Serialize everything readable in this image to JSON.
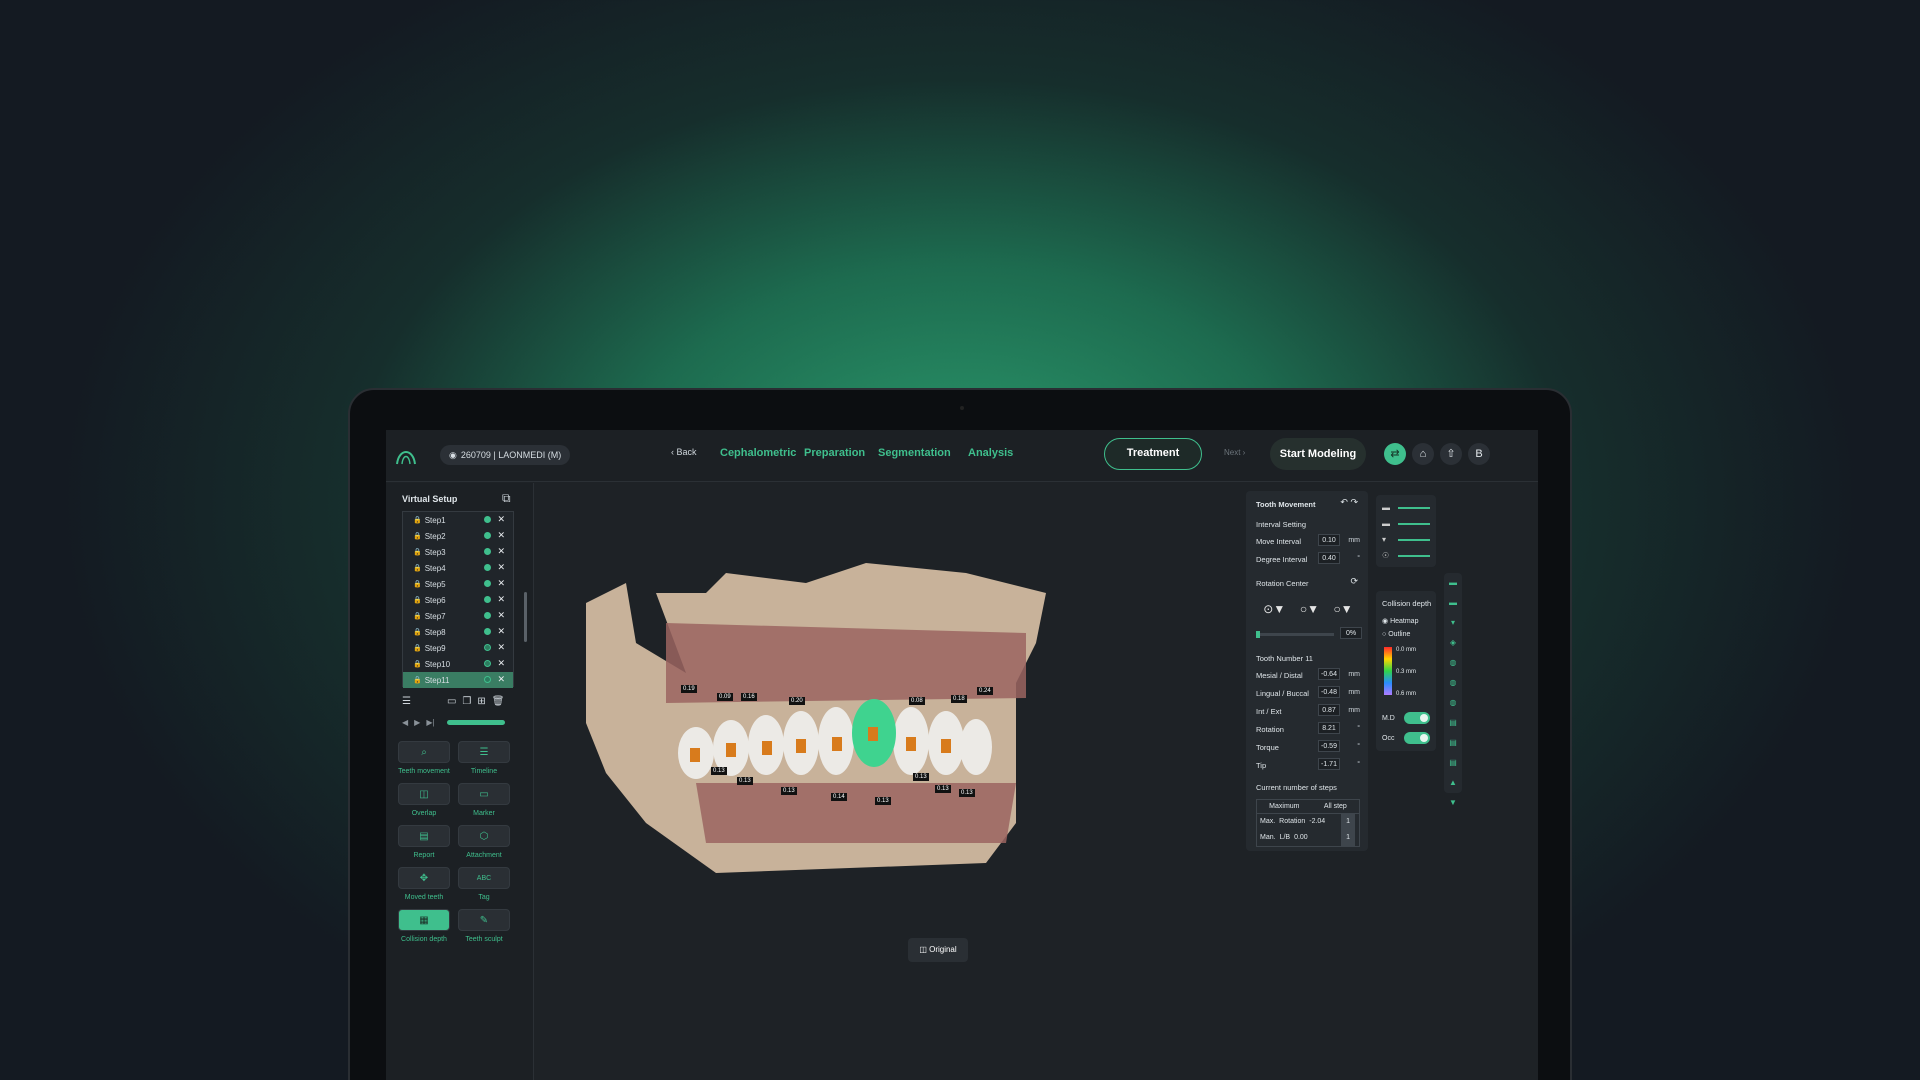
{
  "header": {
    "patient": "260709 | LAONMEDI (M)",
    "back": "Back",
    "tabs": [
      "Cephalometric",
      "Preparation",
      "Segmentation",
      "Analysis"
    ],
    "active_tab": "Treatment",
    "next": "Next",
    "start": "Start Modeling",
    "user_initial": "B"
  },
  "sidebar": {
    "title": "Virtual Setup",
    "steps": [
      "Step1",
      "Step2",
      "Step3",
      "Step4",
      "Step5",
      "Step6",
      "Step7",
      "Step8",
      "Step9",
      "Step10",
      "Step11"
    ],
    "tools": [
      {
        "label": "Teeth movement",
        "icon": "search-icon"
      },
      {
        "label": "Timeline",
        "icon": "timeline-icon"
      },
      {
        "label": "Overlap",
        "icon": "overlap-icon"
      },
      {
        "label": "Marker",
        "icon": "marker-icon"
      },
      {
        "label": "Report",
        "icon": "report-icon"
      },
      {
        "label": "Attachment",
        "icon": "cube-icon"
      },
      {
        "label": "Moved teeth",
        "icon": "move-icon"
      },
      {
        "label": "Tag",
        "icon": "ABC"
      },
      {
        "label": "Collision depth",
        "icon": "collision-icon"
      },
      {
        "label": "Teeth sculpt",
        "icon": "sculpt-icon"
      }
    ]
  },
  "tooth_movement": {
    "title": "Tooth Movement",
    "interval_setting": "Interval Setting",
    "move_interval_label": "Move Interval",
    "move_interval": "0.10",
    "move_unit": "mm",
    "degree_interval_label": "Degree Interval",
    "degree_interval": "0.40",
    "degree_unit": "°",
    "rotation_center": "Rotation Center",
    "percent": "0%",
    "tooth_number": "Tooth Number 11",
    "params": [
      {
        "label": "Mesial / Distal",
        "value": "-0.64",
        "unit": "mm"
      },
      {
        "label": "Lingual / Buccal",
        "value": "-0.48",
        "unit": "mm"
      },
      {
        "label": "Int / Ext",
        "value": "0.87",
        "unit": "mm"
      },
      {
        "label": "Rotation",
        "value": "8.21",
        "unit": "°"
      },
      {
        "label": "Torque",
        "value": "-0.59",
        "unit": "°"
      },
      {
        "label": "Tip",
        "value": "-1.71",
        "unit": "°"
      }
    ],
    "steps_title": "Current number of steps",
    "steps_head": [
      "Maximum",
      "All step"
    ],
    "steps_rows": [
      {
        "label": "Max.",
        "sub": "Rotation",
        "value": "-2.04",
        "step": "1"
      },
      {
        "label": "Man.",
        "sub": "L/B",
        "value": "0.00",
        "step": "1"
      }
    ]
  },
  "collision": {
    "title": "Collision depth",
    "heatmap": "Heatmap",
    "outline": "Outline",
    "scale": [
      "0.0 mm",
      "0.3 mm",
      "0.6 mm"
    ],
    "md": "M.D",
    "occ": "Occ"
  },
  "viewport": {
    "original": "Original",
    "labels": [
      "0.19",
      "0.09",
      "0.16",
      "0.20",
      "0.08",
      "0.18",
      "0.24",
      "0.13",
      "0.13",
      "0.13",
      "0.14",
      "0.13",
      "0.13",
      "0.13",
      "0.13"
    ]
  },
  "colors": {
    "accent": "#3fbf8d",
    "panel": "#252a2f",
    "background": "#1e2226"
  }
}
